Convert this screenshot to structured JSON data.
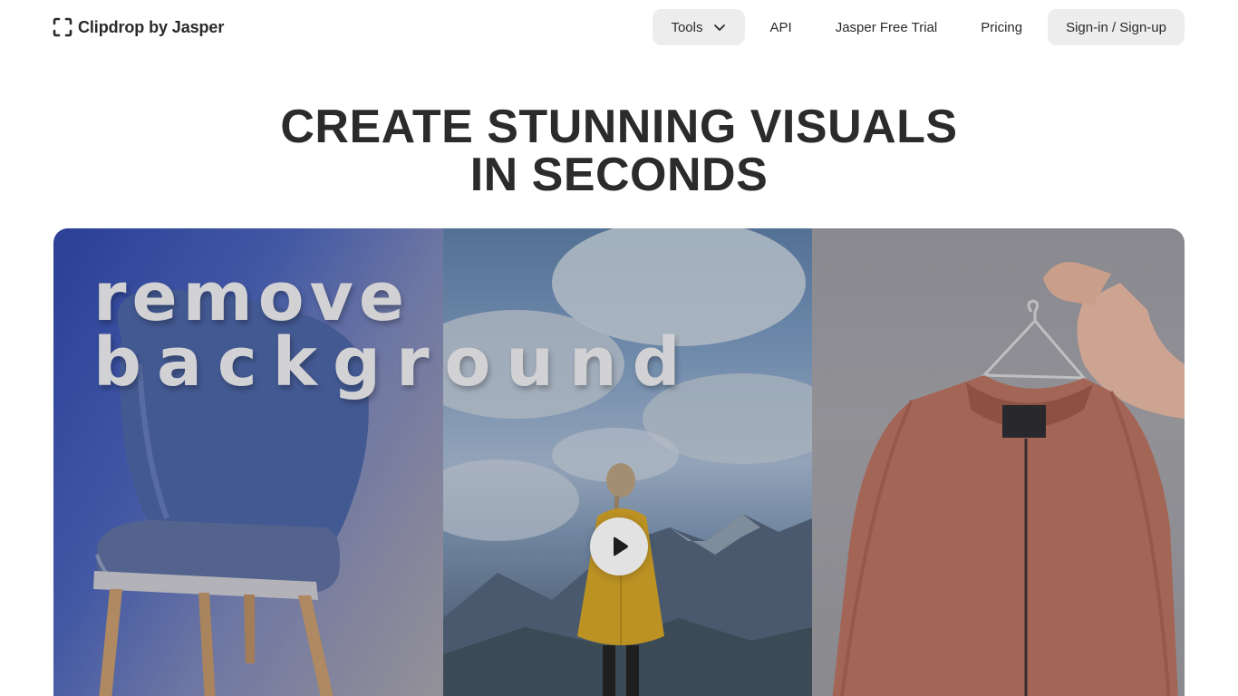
{
  "nav": {
    "logo_text": "Clipdrop by Jasper",
    "items": [
      {
        "label": "Tools"
      },
      {
        "label": "API"
      },
      {
        "label": "Jasper Free Trial"
      },
      {
        "label": "Pricing"
      },
      {
        "label": "Sign-in / Sign-up"
      }
    ]
  },
  "hero": {
    "title_line1": "CREATE STUNNING VISUALS",
    "title_line2": "IN SECONDS"
  },
  "video": {
    "overlay_line1": "remove",
    "overlay_line2": "background",
    "play_icon": "play-icon",
    "panels": [
      "blue chair",
      "child in yellow raincoat facing mountains",
      "pink bomber jacket on hanger"
    ]
  },
  "colors": {
    "text": "#2b2b2b",
    "pill_bg": "#ededed",
    "background": "#ffffff"
  }
}
